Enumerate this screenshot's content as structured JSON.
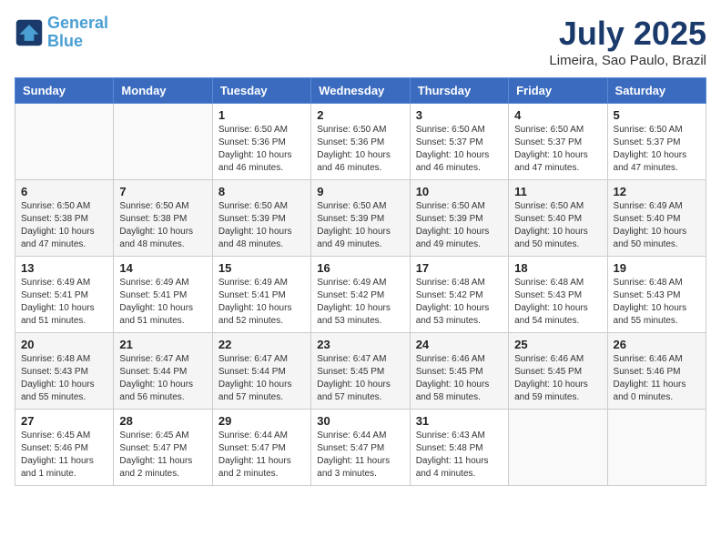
{
  "header": {
    "logo_line1": "General",
    "logo_line2": "Blue",
    "month": "July 2025",
    "location": "Limeira, Sao Paulo, Brazil"
  },
  "weekdays": [
    "Sunday",
    "Monday",
    "Tuesday",
    "Wednesday",
    "Thursday",
    "Friday",
    "Saturday"
  ],
  "weeks": [
    [
      {
        "day": "",
        "info": ""
      },
      {
        "day": "",
        "info": ""
      },
      {
        "day": "1",
        "info": "Sunrise: 6:50 AM\nSunset: 5:36 PM\nDaylight: 10 hours\nand 46 minutes."
      },
      {
        "day": "2",
        "info": "Sunrise: 6:50 AM\nSunset: 5:36 PM\nDaylight: 10 hours\nand 46 minutes."
      },
      {
        "day": "3",
        "info": "Sunrise: 6:50 AM\nSunset: 5:37 PM\nDaylight: 10 hours\nand 46 minutes."
      },
      {
        "day": "4",
        "info": "Sunrise: 6:50 AM\nSunset: 5:37 PM\nDaylight: 10 hours\nand 47 minutes."
      },
      {
        "day": "5",
        "info": "Sunrise: 6:50 AM\nSunset: 5:37 PM\nDaylight: 10 hours\nand 47 minutes."
      }
    ],
    [
      {
        "day": "6",
        "info": "Sunrise: 6:50 AM\nSunset: 5:38 PM\nDaylight: 10 hours\nand 47 minutes."
      },
      {
        "day": "7",
        "info": "Sunrise: 6:50 AM\nSunset: 5:38 PM\nDaylight: 10 hours\nand 48 minutes."
      },
      {
        "day": "8",
        "info": "Sunrise: 6:50 AM\nSunset: 5:39 PM\nDaylight: 10 hours\nand 48 minutes."
      },
      {
        "day": "9",
        "info": "Sunrise: 6:50 AM\nSunset: 5:39 PM\nDaylight: 10 hours\nand 49 minutes."
      },
      {
        "day": "10",
        "info": "Sunrise: 6:50 AM\nSunset: 5:39 PM\nDaylight: 10 hours\nand 49 minutes."
      },
      {
        "day": "11",
        "info": "Sunrise: 6:50 AM\nSunset: 5:40 PM\nDaylight: 10 hours\nand 50 minutes."
      },
      {
        "day": "12",
        "info": "Sunrise: 6:49 AM\nSunset: 5:40 PM\nDaylight: 10 hours\nand 50 minutes."
      }
    ],
    [
      {
        "day": "13",
        "info": "Sunrise: 6:49 AM\nSunset: 5:41 PM\nDaylight: 10 hours\nand 51 minutes."
      },
      {
        "day": "14",
        "info": "Sunrise: 6:49 AM\nSunset: 5:41 PM\nDaylight: 10 hours\nand 51 minutes."
      },
      {
        "day": "15",
        "info": "Sunrise: 6:49 AM\nSunset: 5:41 PM\nDaylight: 10 hours\nand 52 minutes."
      },
      {
        "day": "16",
        "info": "Sunrise: 6:49 AM\nSunset: 5:42 PM\nDaylight: 10 hours\nand 53 minutes."
      },
      {
        "day": "17",
        "info": "Sunrise: 6:48 AM\nSunset: 5:42 PM\nDaylight: 10 hours\nand 53 minutes."
      },
      {
        "day": "18",
        "info": "Sunrise: 6:48 AM\nSunset: 5:43 PM\nDaylight: 10 hours\nand 54 minutes."
      },
      {
        "day": "19",
        "info": "Sunrise: 6:48 AM\nSunset: 5:43 PM\nDaylight: 10 hours\nand 55 minutes."
      }
    ],
    [
      {
        "day": "20",
        "info": "Sunrise: 6:48 AM\nSunset: 5:43 PM\nDaylight: 10 hours\nand 55 minutes."
      },
      {
        "day": "21",
        "info": "Sunrise: 6:47 AM\nSunset: 5:44 PM\nDaylight: 10 hours\nand 56 minutes."
      },
      {
        "day": "22",
        "info": "Sunrise: 6:47 AM\nSunset: 5:44 PM\nDaylight: 10 hours\nand 57 minutes."
      },
      {
        "day": "23",
        "info": "Sunrise: 6:47 AM\nSunset: 5:45 PM\nDaylight: 10 hours\nand 57 minutes."
      },
      {
        "day": "24",
        "info": "Sunrise: 6:46 AM\nSunset: 5:45 PM\nDaylight: 10 hours\nand 58 minutes."
      },
      {
        "day": "25",
        "info": "Sunrise: 6:46 AM\nSunset: 5:45 PM\nDaylight: 10 hours\nand 59 minutes."
      },
      {
        "day": "26",
        "info": "Sunrise: 6:46 AM\nSunset: 5:46 PM\nDaylight: 11 hours\nand 0 minutes."
      }
    ],
    [
      {
        "day": "27",
        "info": "Sunrise: 6:45 AM\nSunset: 5:46 PM\nDaylight: 11 hours\nand 1 minute."
      },
      {
        "day": "28",
        "info": "Sunrise: 6:45 AM\nSunset: 5:47 PM\nDaylight: 11 hours\nand 2 minutes."
      },
      {
        "day": "29",
        "info": "Sunrise: 6:44 AM\nSunset: 5:47 PM\nDaylight: 11 hours\nand 2 minutes."
      },
      {
        "day": "30",
        "info": "Sunrise: 6:44 AM\nSunset: 5:47 PM\nDaylight: 11 hours\nand 3 minutes."
      },
      {
        "day": "31",
        "info": "Sunrise: 6:43 AM\nSunset: 5:48 PM\nDaylight: 11 hours\nand 4 minutes."
      },
      {
        "day": "",
        "info": ""
      },
      {
        "day": "",
        "info": ""
      }
    ]
  ]
}
